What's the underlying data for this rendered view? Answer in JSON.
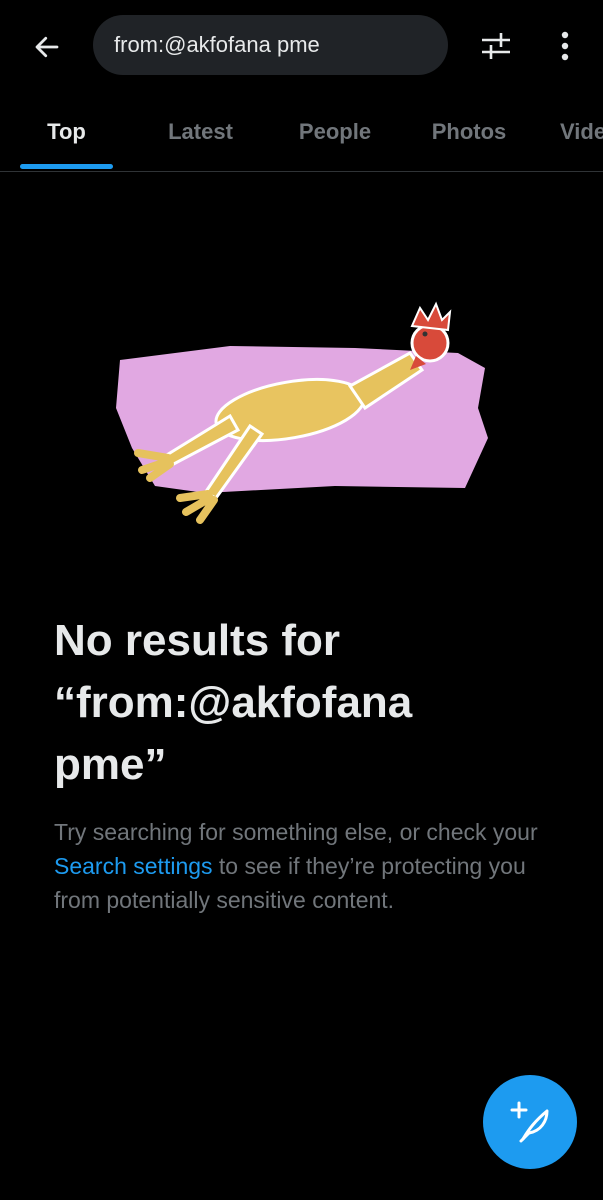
{
  "header": {
    "back_icon": "arrow-left-icon",
    "search_value": "from:@akfofana pme",
    "filter_icon": "sliders-icon",
    "more_icon": "vertical-ellipsis-icon"
  },
  "tabs": [
    {
      "label": "Top",
      "active": true
    },
    {
      "label": "Latest",
      "active": false
    },
    {
      "label": "People",
      "active": false
    },
    {
      "label": "Photos",
      "active": false
    },
    {
      "label": "Videos",
      "active": false
    }
  ],
  "empty_state": {
    "title_line1": "No results for",
    "title_line2": "“from:@akfofana",
    "title_line3": "pme”",
    "desc_before": "Try searching for something else, or check your ",
    "desc_link": "Search settings",
    "desc_after": " to see if they’re protecting you from potentially sensitive content."
  },
  "fab": {
    "icon": "compose-feather-plus-icon"
  },
  "colors": {
    "background": "#000000",
    "accent": "#1d9bf0",
    "text_primary": "#e7e9ea",
    "text_secondary": "#71767b",
    "search_bg": "#202327",
    "illustration_bg": "#e1a8e2"
  }
}
